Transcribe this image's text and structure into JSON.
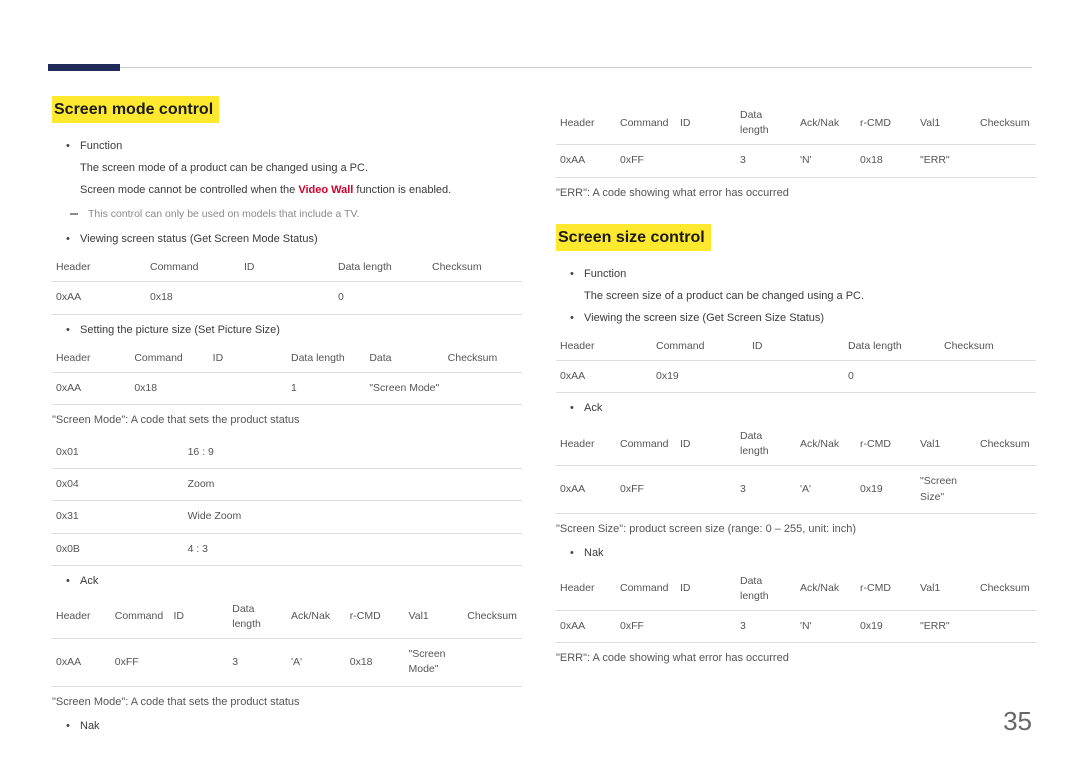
{
  "page_number": "35",
  "left": {
    "heading": "Screen mode control",
    "function_label": "Function",
    "function_line1": "The screen mode of a product can be changed using a PC.",
    "function_line2_pre": "Screen mode cannot be controlled when the ",
    "function_line2_red": "Video Wall",
    "function_line2_post": " function is enabled.",
    "tip": "This control can only be used on models that include a TV.",
    "view_label": "Viewing screen status (Get Screen Mode Status)",
    "table_view": {
      "headers": [
        "Header",
        "Command",
        "ID",
        "Data length",
        "Checksum"
      ],
      "row": [
        "0xAA",
        "0x18",
        "",
        "0",
        ""
      ]
    },
    "set_label": "Setting the picture size (Set Picture Size)",
    "table_set": {
      "headers": [
        "Header",
        "Command",
        "ID",
        "Data length",
        "Data",
        "Checksum"
      ],
      "row": [
        "0xAA",
        "0x18",
        "",
        "1",
        "\"Screen Mode\"",
        ""
      ]
    },
    "code_note": "\"Screen Mode\": A code that sets the product status",
    "codes": [
      [
        "0x01",
        "16 : 9"
      ],
      [
        "0x04",
        "Zoom"
      ],
      [
        "0x31",
        "Wide Zoom"
      ],
      [
        "0x0B",
        "4 : 3"
      ]
    ],
    "ack_label": "Ack",
    "table_ack": {
      "headers": [
        "Header",
        "Command",
        "ID",
        "Data length",
        "Ack/Nak",
        "r-CMD",
        "Val1",
        "Checksum"
      ],
      "row": [
        "0xAA",
        "0xFF",
        "",
        "3",
        "'A'",
        "0x18",
        "\"Screen Mode\"",
        ""
      ]
    },
    "code_note2": "\"Screen Mode\": A code that sets the product status",
    "nak_label": "Nak"
  },
  "right": {
    "table_nak": {
      "headers": [
        "Header",
        "Command",
        "ID",
        "Data length",
        "Ack/Nak",
        "r-CMD",
        "Val1",
        "Checksum"
      ],
      "row": [
        "0xAA",
        "0xFF",
        "",
        "3",
        "'N'",
        "0x18",
        "\"ERR\"",
        ""
      ]
    },
    "err_note": "\"ERR\": A code showing what error has occurred",
    "heading": "Screen size control",
    "function_label": "Function",
    "function_line1": "The screen size of a product can be changed using a PC.",
    "view_label": "Viewing the screen size (Get Screen Size Status)",
    "table_view": {
      "headers": [
        "Header",
        "Command",
        "ID",
        "Data length",
        "Checksum"
      ],
      "row": [
        "0xAA",
        "0x19",
        "",
        "0",
        ""
      ]
    },
    "ack_label": "Ack",
    "table_ack": {
      "headers": [
        "Header",
        "Command",
        "ID",
        "Data length",
        "Ack/Nak",
        "r-CMD",
        "Val1",
        "Checksum"
      ],
      "row": [
        "0xAA",
        "0xFF",
        "",
        "3",
        "'A'",
        "0x19",
        "\"Screen Size\"",
        ""
      ]
    },
    "size_note": "\"Screen Size\": product screen size (range: 0 – 255, unit: inch)",
    "nak_label": "Nak",
    "table_nak2": {
      "headers": [
        "Header",
        "Command",
        "ID",
        "Data length",
        "Ack/Nak",
        "r-CMD",
        "Val1",
        "Checksum"
      ],
      "row": [
        "0xAA",
        "0xFF",
        "",
        "3",
        "'N'",
        "0x19",
        "\"ERR\"",
        ""
      ]
    },
    "err_note2": "\"ERR\": A code showing what error has occurred"
  }
}
